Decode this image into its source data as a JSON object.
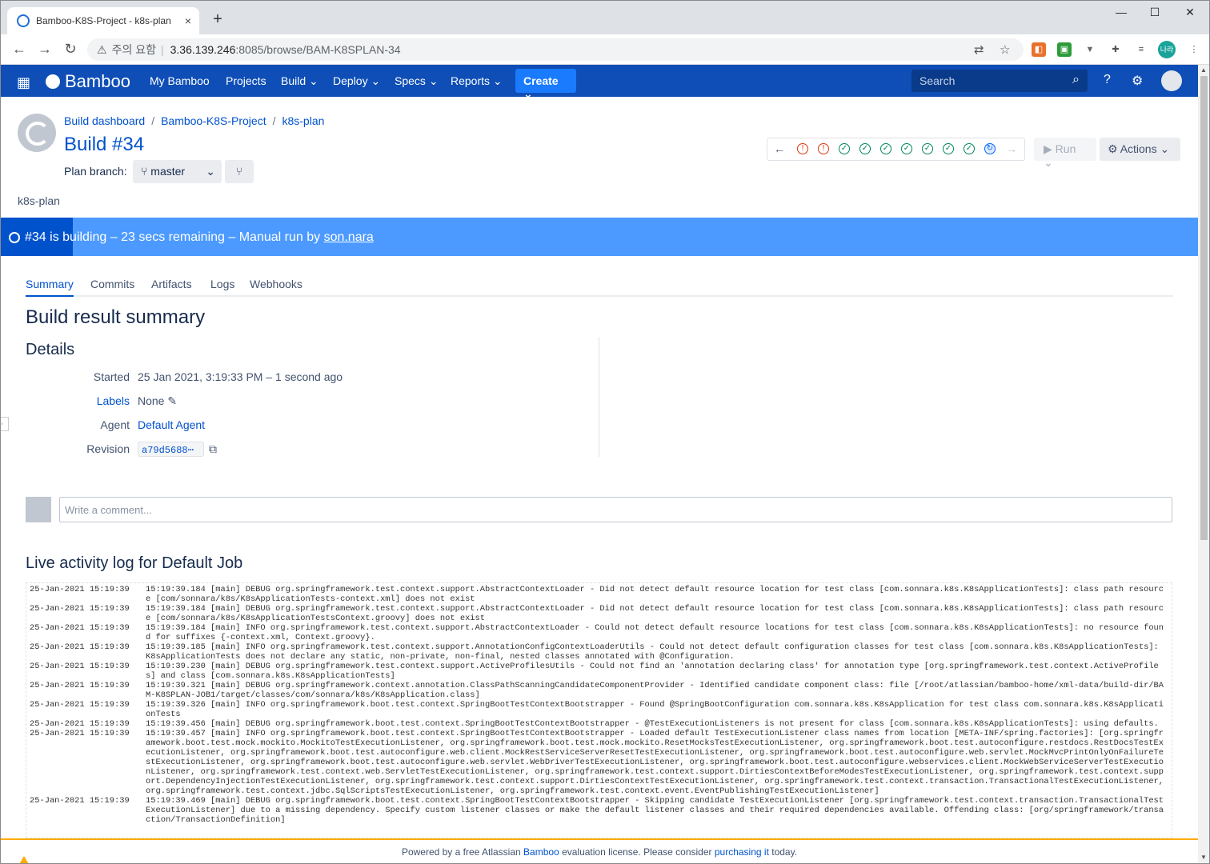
{
  "browser": {
    "tab_title": "Bamboo-K8S-Project - k8s-plan",
    "tab_close": "×",
    "new_tab": "+",
    "security_label": "주의 요함",
    "url_host": "3.36.139.246",
    "url_path": ":8085/browse/BAM-K8SPLAN-34",
    "profile_badge": "나라"
  },
  "header": {
    "logo": "Bamboo",
    "menu": [
      "My Bamboo",
      "Projects",
      "Build",
      "Deploy",
      "Specs",
      "Reports"
    ],
    "create": "Create",
    "search_placeholder": "Search"
  },
  "breadcrumb": [
    "Build dashboard",
    "Bamboo-K8S-Project",
    "k8s-plan"
  ],
  "build_title": "Build #34",
  "plan_branch_label": "Plan branch:",
  "plan_branch_value": "master",
  "plan_name": "k8s-plan",
  "history_icons": [
    "failed",
    "failed",
    "success",
    "success",
    "success",
    "success",
    "success",
    "success",
    "success",
    "building"
  ],
  "run_button": "Run",
  "actions_button": "Actions",
  "banner": {
    "text": "#34 is building – 23 secs remaining – Manual run by ",
    "user": "son.nara",
    "progress": 0.06
  },
  "tabs": [
    "Summary",
    "Commits",
    "Artifacts",
    "Logs",
    "Webhooks"
  ],
  "summary_title": "Build result summary",
  "details_title": "Details",
  "details": {
    "started_label": "Started",
    "started_value": "25 Jan 2021, 3:19:33 PM – 1 second ago",
    "labels_label": "Labels",
    "labels_value": "None",
    "agent_label": "Agent",
    "agent_value": "Default Agent",
    "revision_label": "Revision",
    "revision_value": "a79d5688⋯"
  },
  "comment_placeholder": "Write a comment...",
  "log_title": "Live activity log for Default Job",
  "log": [
    {
      "t": "25-Jan-2021 15:19:39",
      "m": "15:19:39.184 [main] DEBUG org.springframework.test.context.support.AbstractContextLoader - Did not detect default resource location for test class [com.sonnara.k8s.K8sApplicationTests]: class path resource [com/sonnara/k8s/K8sApplicationTests-context.xml] does not exist"
    },
    {
      "t": "25-Jan-2021 15:19:39",
      "m": "15:19:39.184 [main] DEBUG org.springframework.test.context.support.AbstractContextLoader - Did not detect default resource location for test class [com.sonnara.k8s.K8sApplicationTests]: class path resource [com/sonnara/k8s/K8sApplicationTestsContext.groovy] does not exist"
    },
    {
      "t": "25-Jan-2021 15:19:39",
      "m": "15:19:39.184 [main] INFO org.springframework.test.context.support.AbstractContextLoader - Could not detect default resource locations for test class [com.sonnara.k8s.K8sApplicationTests]: no resource found for suffixes {-context.xml, Context.groovy}."
    },
    {
      "t": "25-Jan-2021 15:19:39",
      "m": "15:19:39.185 [main] INFO org.springframework.test.context.support.AnnotationConfigContextLoaderUtils - Could not detect default configuration classes for test class [com.sonnara.k8s.K8sApplicationTests]: K8sApplicationTests does not declare any static, non-private, non-final, nested classes annotated with @Configuration."
    },
    {
      "t": "25-Jan-2021 15:19:39",
      "m": "15:19:39.230 [main] DEBUG org.springframework.test.context.support.ActiveProfilesUtils - Could not find an 'annotation declaring class' for annotation type [org.springframework.test.context.ActiveProfiles] and class [com.sonnara.k8s.K8sApplicationTests]"
    },
    {
      "t": "25-Jan-2021 15:19:39",
      "m": "15:19:39.321 [main] DEBUG org.springframework.context.annotation.ClassPathScanningCandidateComponentProvider - Identified candidate component class: file [/root/atlassian/bamboo-home/xml-data/build-dir/BAM-K8SPLAN-JOB1/target/classes/com/sonnara/k8s/K8sApplication.class]"
    },
    {
      "t": "25-Jan-2021 15:19:39",
      "m": "15:19:39.326 [main] INFO org.springframework.boot.test.context.SpringBootTestContextBootstrapper - Found @SpringBootConfiguration com.sonnara.k8s.K8sApplication for test class com.sonnara.k8s.K8sApplicationTests"
    },
    {
      "t": "25-Jan-2021 15:19:39",
      "m": "15:19:39.456 [main] DEBUG org.springframework.boot.test.context.SpringBootTestContextBootstrapper - @TestExecutionListeners is not present for class [com.sonnara.k8s.K8sApplicationTests]: using defaults."
    },
    {
      "t": "25-Jan-2021 15:19:39",
      "m": "15:19:39.457 [main] INFO org.springframework.boot.test.context.SpringBootTestContextBootstrapper - Loaded default TestExecutionListener class names from location [META-INF/spring.factories]: [org.springframework.boot.test.mock.mockito.MockitoTestExecutionListener, org.springframework.boot.test.mock.mockito.ResetMocksTestExecutionListener, org.springframework.boot.test.autoconfigure.restdocs.RestDocsTestExecutionListener, org.springframework.boot.test.autoconfigure.web.client.MockRestServiceServerResetTestExecutionListener, org.springframework.boot.test.autoconfigure.web.servlet.MockMvcPrintOnlyOnFailureTestExecutionListener, org.springframework.boot.test.autoconfigure.web.servlet.WebDriverTestExecutionListener, org.springframework.boot.test.autoconfigure.webservices.client.MockWebServiceServerTestExecutionListener, org.springframework.test.context.web.ServletTestExecutionListener, org.springframework.test.context.support.DirtiesContextBeforeModesTestExecutionListener, org.springframework.test.context.support.DependencyInjectionTestExecutionListener, org.springframework.test.context.support.DirtiesContextTestExecutionListener, org.springframework.test.context.transaction.TransactionalTestExecutionListener, org.springframework.test.context.jdbc.SqlScriptsTestExecutionListener, org.springframework.test.context.event.EventPublishingTestExecutionListener]"
    },
    {
      "t": "25-Jan-2021 15:19:39",
      "m": "15:19:39.469 [main] DEBUG org.springframework.boot.test.context.SpringBootTestContextBootstrapper - Skipping candidate TestExecutionListener [org.springframework.test.context.transaction.TransactionalTestExecutionListener] due to a missing dependency. Specify custom listener classes or make the default listener classes and their required dependencies available. Offending class: [org/springframework/transaction/TransactionDefinition]"
    }
  ],
  "footer": {
    "prefix": "Powered by a free Atlassian ",
    "product": "Bamboo",
    "middle": " evaluation license. Please consider ",
    "link": "purchasing it",
    "suffix": " today."
  },
  "colors": {
    "header": "#0e4eb6",
    "create": "#1a7bff",
    "banner": "#4c9aff",
    "link": "#0052cc",
    "success": "#00875a",
    "failed": "#de350b"
  }
}
